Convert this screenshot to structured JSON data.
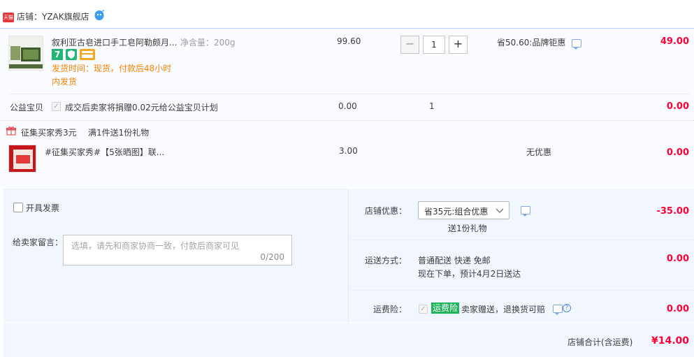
{
  "shop": {
    "badge": "天猫",
    "label": "店铺：YZAK旗舰店"
  },
  "items": [
    {
      "title": "叙利亚古皂进口手工皂阿勒颇月...",
      "spec": "净含量：200g",
      "price": "99.60",
      "quantity": "1",
      "discount": "省50.60:品牌钜惠",
      "total": "49.00",
      "shipping_line1": "发货时间：现货，付款后48小时",
      "shipping_line2": "内发货",
      "badge7": "7"
    },
    {
      "title_label": "公益宝贝",
      "charity_text": "成交后卖家将捐赠0.02元给公益宝贝计划",
      "price": "0.00",
      "quantity": "1",
      "total": "0.00"
    }
  ],
  "gift": {
    "header_title": "征集买家秀3元",
    "header_desc": "满1件送1份礼物",
    "title": "#征集买家秀#【5张晒图】联...",
    "price": "3.00",
    "discount": "无优惠",
    "total": "0.00"
  },
  "invoice": {
    "label": "开具发票"
  },
  "message": {
    "label": "给卖家留言：",
    "placeholder": "选填，请先和商家协商一致，付款后商家可见",
    "counter": "0/200"
  },
  "shop_discount": {
    "label": "店铺优惠：",
    "selected": "省35元:组合优惠",
    "sub": "送1份礼物",
    "amount": "-35.00"
  },
  "shipping": {
    "label": "运送方式：",
    "method": "普通配送 快递 免邮",
    "eta": "现在下单，预计4月2日送达",
    "amount": "0.00"
  },
  "insurance": {
    "label": "运费险：",
    "badge": "运费险",
    "desc": "卖家赠送，退换货可赔",
    "amount": "0.00"
  },
  "total": {
    "label": "店铺合计(含运费)",
    "amount": "¥14.00"
  },
  "colors": {
    "accent_red": "#ff0036",
    "orange": "#ff8000",
    "green": "#1fb35c",
    "light_blue_bg": "#f2f7ff"
  }
}
